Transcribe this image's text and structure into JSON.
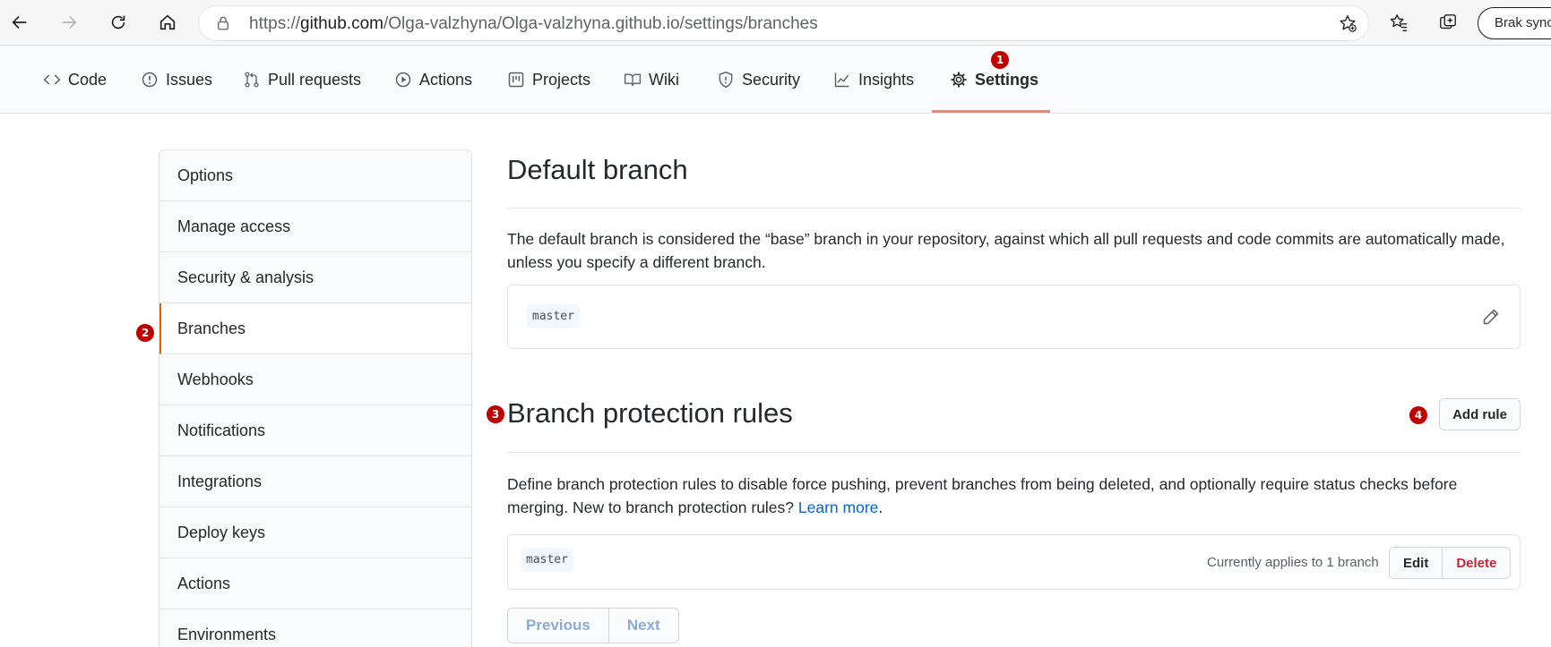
{
  "browser": {
    "url_prefix": "https://",
    "url_host": "github.com",
    "url_path": "/Olga-valzhyna/Olga-valzhyna.github.io/settings/branches",
    "profile_label": "Brak sync"
  },
  "repo_nav": {
    "tabs": [
      {
        "label": "Code",
        "icon": "code-icon"
      },
      {
        "label": "Issues",
        "icon": "issue-icon"
      },
      {
        "label": "Pull requests",
        "icon": "pull-request-icon"
      },
      {
        "label": "Actions",
        "icon": "play-icon"
      },
      {
        "label": "Projects",
        "icon": "project-icon"
      },
      {
        "label": "Wiki",
        "icon": "book-icon"
      },
      {
        "label": "Security",
        "icon": "shield-icon"
      },
      {
        "label": "Insights",
        "icon": "graph-icon"
      },
      {
        "label": "Settings",
        "icon": "gear-icon",
        "selected": true
      }
    ]
  },
  "annotations": {
    "badge_1": "1",
    "badge_2": "2",
    "badge_3": "3",
    "badge_4": "4",
    "badge_color": "#c00000"
  },
  "sidebar": {
    "items": [
      {
        "label": "Options"
      },
      {
        "label": "Manage access"
      },
      {
        "label": "Security & analysis"
      },
      {
        "label": "Branches",
        "active": true
      },
      {
        "label": "Webhooks"
      },
      {
        "label": "Notifications"
      },
      {
        "label": "Integrations"
      },
      {
        "label": "Deploy keys"
      },
      {
        "label": "Actions"
      },
      {
        "label": "Environments"
      }
    ]
  },
  "default_branch": {
    "title": "Default branch",
    "description": "The default branch is considered the “base” branch in your repository, against which all pull requests and code commits are automatically made, unless you specify a different branch.",
    "branch": "master"
  },
  "protection": {
    "title": "Branch protection rules",
    "add_rule_label": "Add rule",
    "description": "Define branch protection rules to disable force pushing, prevent branches from being deleted, and optionally require status checks before merging. New to branch protection rules?",
    "learn_more": "Learn more",
    "learn_more_suffix": ".",
    "rule_branch": "master",
    "applies_text": "Currently applies to 1 branch",
    "edit_label": "Edit",
    "delete_label": "Delete"
  },
  "pagination": {
    "previous": "Previous",
    "next": "Next"
  },
  "colors": {
    "accent_tab": "#f9826c",
    "link": "#0366d6",
    "delete": "#cb2431"
  }
}
